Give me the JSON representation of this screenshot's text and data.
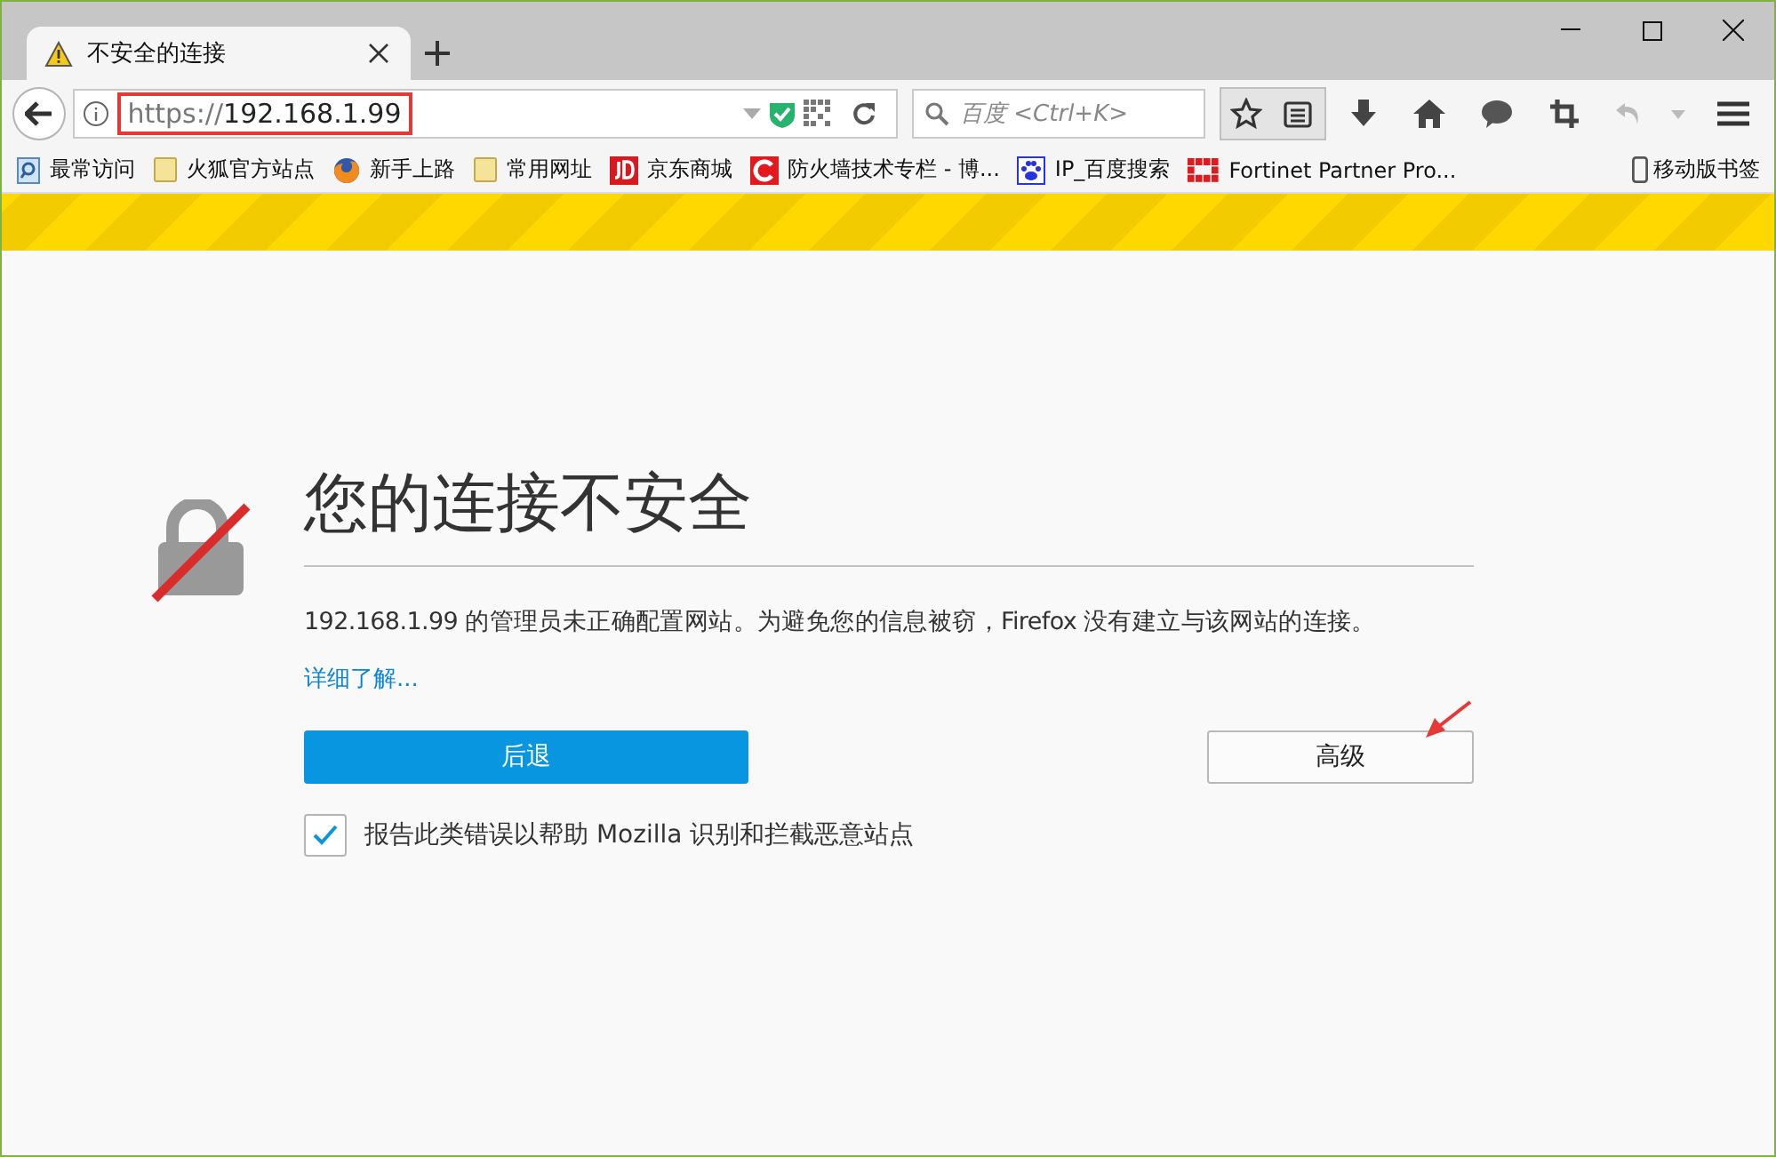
{
  "tabs": [
    {
      "title": "不安全的连接",
      "selected": true
    }
  ],
  "toolbar": {
    "url_scheme": "https://",
    "url_host": "192.168.1.99",
    "search_placeholder": "百度 <Ctrl+K>"
  },
  "bookmarks": [
    {
      "label": "最常访问",
      "kind": "search"
    },
    {
      "label": "火狐官方站点",
      "kind": "folder"
    },
    {
      "label": "新手上路",
      "kind": "firefox"
    },
    {
      "label": "常用网址",
      "kind": "folder"
    },
    {
      "label": "京东商城",
      "kind": "jd"
    },
    {
      "label": "防火墙技术专栏 - 博...",
      "kind": "csdn"
    },
    {
      "label": "IP_百度搜索",
      "kind": "baidu"
    },
    {
      "label": "Fortinet Partner Pro...",
      "kind": "fortinet"
    }
  ],
  "mobile_bookmarks": "移动版书签",
  "page": {
    "title": "您的连接不安全",
    "message": "192.168.1.99 的管理员未正确配置网站。为避免您的信息被窃，Firefox 没有建立与该网站的连接。",
    "link": "详细了解...",
    "back_button": "后退",
    "advanced_button": "高级",
    "report": {
      "label": "报告此类错误以帮助 Mozilla 识别和拦截恶意站点",
      "checked": true
    }
  }
}
